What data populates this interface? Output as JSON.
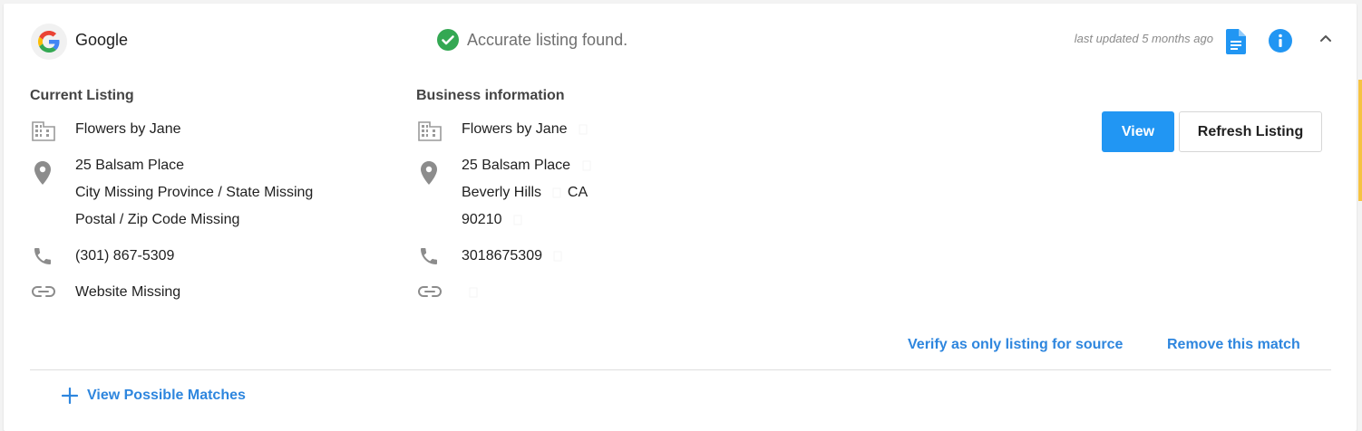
{
  "source": {
    "name": "Google",
    "status_text": "Accurate listing found.",
    "last_updated": "last updated 5 months ago"
  },
  "current_listing": {
    "title": "Current Listing",
    "name": "Flowers by Jane",
    "address_line1": "25 Balsam Place",
    "address_city": "City Missing",
    "address_state": "Province / State Missing",
    "address_postal": "Postal / Zip Code Missing",
    "phone": "(301) 867-5309",
    "website": "Website Missing"
  },
  "business_info": {
    "title": "Business information",
    "name": "Flowers by Jane",
    "address_line1": "25 Balsam Place",
    "city": "Beverly Hills",
    "state": "CA",
    "postal": "90210",
    "phone": "3018675309",
    "website": ""
  },
  "actions": {
    "view_label": "View",
    "refresh_label": "Refresh Listing",
    "verify_label": "Verify as only listing for source",
    "remove_label": "Remove this match",
    "possible_matches_label": "View Possible Matches"
  },
  "colors": {
    "primary": "#2196f3",
    "link": "#2e86de",
    "success": "#34a853",
    "icon_gray": "#8c8c8c",
    "accent_bar": "#f6c343"
  },
  "icons": {
    "logo": "google-logo-icon",
    "status": "check-circle-icon",
    "report": "document-icon",
    "info": "info-icon",
    "collapse": "chevron-up-icon",
    "business": "building-icon",
    "address": "location-pin-icon",
    "phone": "phone-icon",
    "website": "link-icon",
    "copy": "copy-icon",
    "add": "plus-icon"
  }
}
